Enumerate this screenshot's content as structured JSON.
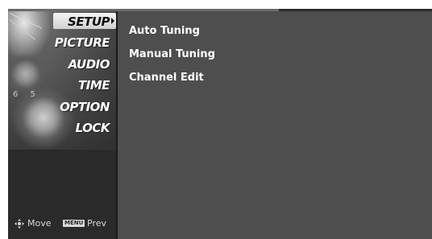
{
  "menu": {
    "items": [
      {
        "label": "SETUP",
        "selected": true
      },
      {
        "label": "PICTURE",
        "selected": false
      },
      {
        "label": "AUDIO",
        "selected": false
      },
      {
        "label": "TIME",
        "selected": false
      },
      {
        "label": "OPTION",
        "selected": false
      },
      {
        "label": "LOCK",
        "selected": false
      }
    ],
    "art_numbers": "6 5",
    "art_badge": "OPTION"
  },
  "submenu": {
    "items": [
      "Auto Tuning",
      "Manual Tuning",
      "Channel Edit"
    ]
  },
  "hints": {
    "move_label": "Move",
    "menu_key": "MENU",
    "prev_label": "Prev"
  },
  "icons": {
    "selection_arrow": "chevron-right-icon",
    "navigate": "move-cross-icon"
  },
  "colors": {
    "panel_bg": "#4e4e4e",
    "menu_bg": "#2a2a2a",
    "selected_bg": "#e0e0e0",
    "text": "#ffffff"
  }
}
